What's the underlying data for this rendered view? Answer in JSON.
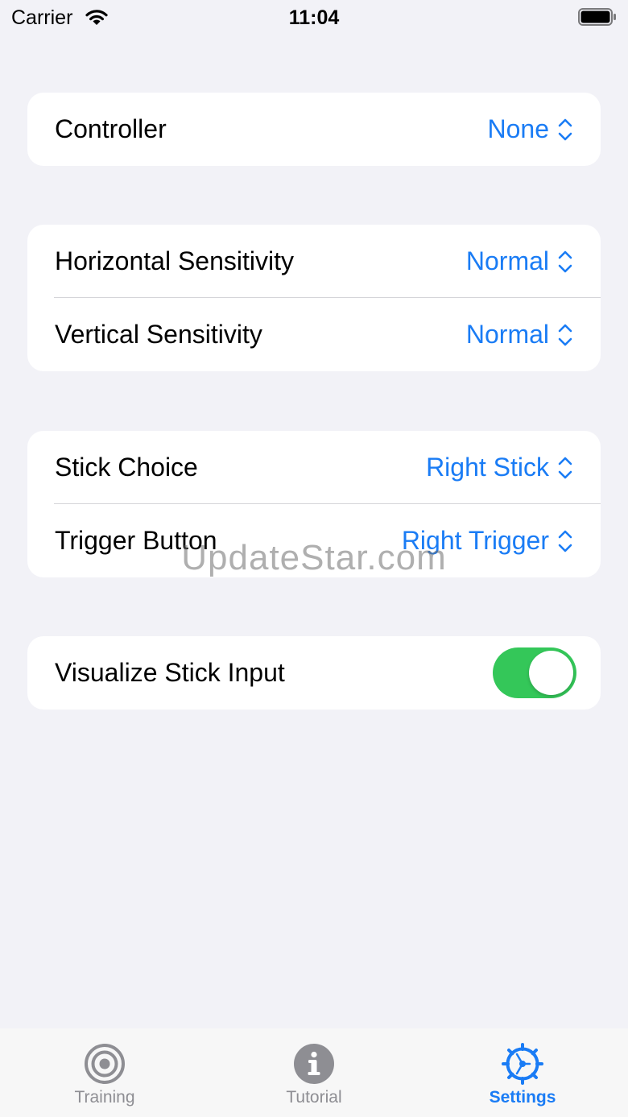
{
  "status_bar": {
    "carrier": "Carrier",
    "time": "11:04"
  },
  "settings": {
    "controller": {
      "label": "Controller",
      "value": "None"
    },
    "horizontal_sensitivity": {
      "label": "Horizontal Sensitivity",
      "value": "Normal"
    },
    "vertical_sensitivity": {
      "label": "Vertical Sensitivity",
      "value": "Normal"
    },
    "stick_choice": {
      "label": "Stick Choice",
      "value": "Right Stick"
    },
    "trigger_button": {
      "label": "Trigger Button",
      "value": "Right Trigger"
    },
    "visualize_stick_input": {
      "label": "Visualize Stick Input",
      "enabled": true
    }
  },
  "watermark": "UpdateStar.com",
  "tabs": [
    {
      "label": "Training",
      "icon": "target-icon",
      "active": false
    },
    {
      "label": "Tutorial",
      "icon": "info-icon",
      "active": false
    },
    {
      "label": "Settings",
      "icon": "gear-icon",
      "active": true
    }
  ],
  "colors": {
    "accent": "#1a7cf5",
    "toggle_on": "#34c759",
    "background": "#f2f2f7",
    "inactive_tab": "#8e8e93"
  }
}
